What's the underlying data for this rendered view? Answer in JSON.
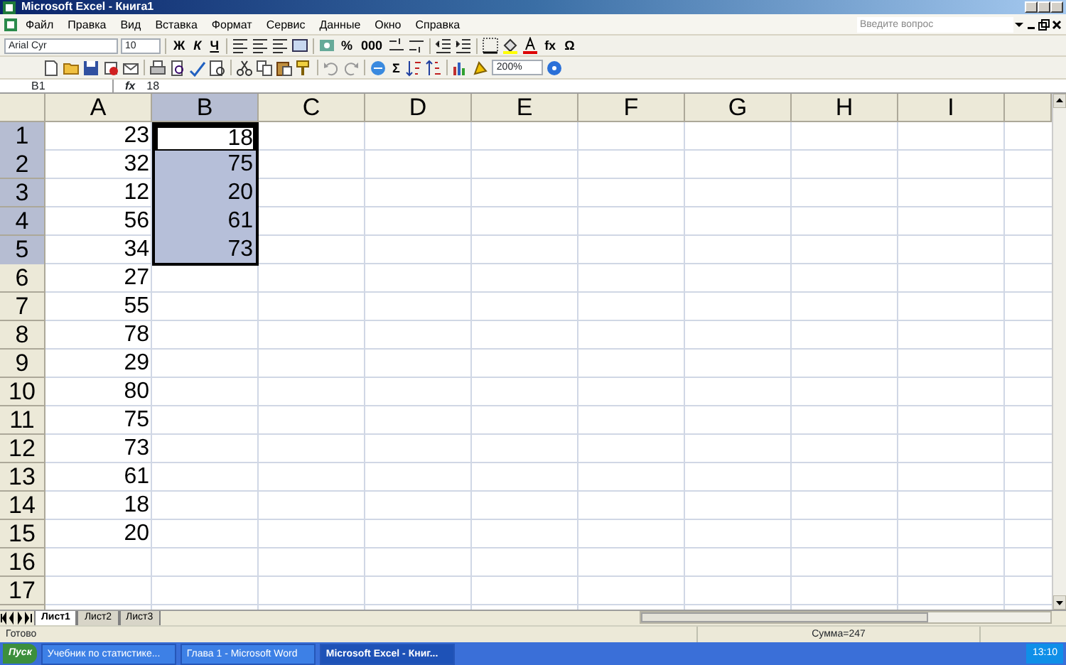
{
  "window": {
    "title": "Microsoft Excel - Книга1"
  },
  "menu": [
    "Файл",
    "Правка",
    "Вид",
    "Вставка",
    "Формат",
    "Сервис",
    "Данные",
    "Окно",
    "Справка"
  ],
  "help_search": {
    "placeholder": "Введите вопрос"
  },
  "formatting_toolbar": {
    "font": "Arial Cyr",
    "size": "10",
    "style_buttons": [
      "Ж",
      "К",
      "Ч"
    ],
    "number_buttons": [
      "%",
      "000"
    ],
    "function_button": "fx",
    "symbol_button": "Ω"
  },
  "standard_toolbar": {
    "autosum": "Σ",
    "zoom": "200%"
  },
  "formula_bar": {
    "name_box": "B1",
    "function_label": "fx",
    "value": "18"
  },
  "columns": [
    {
      "label": "A",
      "selected": false
    },
    {
      "label": "B",
      "selected": true
    },
    {
      "label": "C",
      "selected": false
    },
    {
      "label": "D",
      "selected": false
    },
    {
      "label": "E",
      "selected": false
    },
    {
      "label": "F",
      "selected": false
    },
    {
      "label": "G",
      "selected": false
    },
    {
      "label": "H",
      "selected": false
    },
    {
      "label": "I",
      "selected": false
    }
  ],
  "rows": [
    {
      "number": "1",
      "selected": true,
      "cells": [
        {
          "value": "23",
          "selected": false,
          "active": false
        },
        {
          "value": "18",
          "selected": true,
          "active": true
        }
      ]
    },
    {
      "number": "2",
      "selected": true,
      "cells": [
        {
          "value": "32",
          "selected": false,
          "active": false
        },
        {
          "value": "75",
          "selected": true,
          "active": false
        }
      ]
    },
    {
      "number": "3",
      "selected": true,
      "cells": [
        {
          "value": "12",
          "selected": false,
          "active": false
        },
        {
          "value": "20",
          "selected": true,
          "active": false
        }
      ]
    },
    {
      "number": "4",
      "selected": true,
      "cells": [
        {
          "value": "56",
          "selected": false,
          "active": false
        },
        {
          "value": "61",
          "selected": true,
          "active": false
        }
      ]
    },
    {
      "number": "5",
      "selected": true,
      "cells": [
        {
          "value": "34",
          "selected": false,
          "active": false
        },
        {
          "value": "73",
          "selected": true,
          "active": false
        }
      ]
    },
    {
      "number": "6",
      "selected": false,
      "cells": [
        {
          "value": "27",
          "selected": false,
          "active": false
        }
      ]
    },
    {
      "number": "7",
      "selected": false,
      "cells": [
        {
          "value": "55",
          "selected": false,
          "active": false
        }
      ]
    },
    {
      "number": "8",
      "selected": false,
      "cells": [
        {
          "value": "78",
          "selected": false,
          "active": false
        }
      ]
    },
    {
      "number": "9",
      "selected": false,
      "cells": [
        {
          "value": "29",
          "selected": false,
          "active": false
        }
      ]
    },
    {
      "number": "10",
      "selected": false,
      "cells": [
        {
          "value": "80",
          "selected": false,
          "active": false
        }
      ]
    },
    {
      "number": "11",
      "selected": false,
      "cells": [
        {
          "value": "75",
          "selected": false,
          "active": false
        }
      ]
    },
    {
      "number": "12",
      "selected": false,
      "cells": [
        {
          "value": "73",
          "selected": false,
          "active": false
        }
      ]
    },
    {
      "number": "13",
      "selected": false,
      "cells": [
        {
          "value": "61",
          "selected": false,
          "active": false
        }
      ]
    },
    {
      "number": "14",
      "selected": false,
      "cells": [
        {
          "value": "18",
          "selected": false,
          "active": false
        }
      ]
    },
    {
      "number": "15",
      "selected": false,
      "cells": [
        {
          "value": "20",
          "selected": false,
          "active": false
        }
      ]
    },
    {
      "number": "16",
      "selected": false,
      "cells": []
    },
    {
      "number": "17",
      "selected": false,
      "cells": []
    }
  ],
  "sheet_tabs": [
    {
      "label": "Лист1",
      "selected": true
    },
    {
      "label": "Лист2",
      "selected": false
    },
    {
      "label": "Лист3",
      "selected": false
    }
  ],
  "status_bar": {
    "status": "Готово",
    "sum": "Сумма=247"
  },
  "taskbar": {
    "start": "Пуск",
    "tasks": [
      {
        "label": "Учебник по статистике...",
        "selected": false
      },
      {
        "label": "Глава 1 - Microsoft Word",
        "selected": false
      },
      {
        "label": "Microsoft Excel - Книг...",
        "selected": true
      }
    ],
    "clock": "13:10"
  }
}
